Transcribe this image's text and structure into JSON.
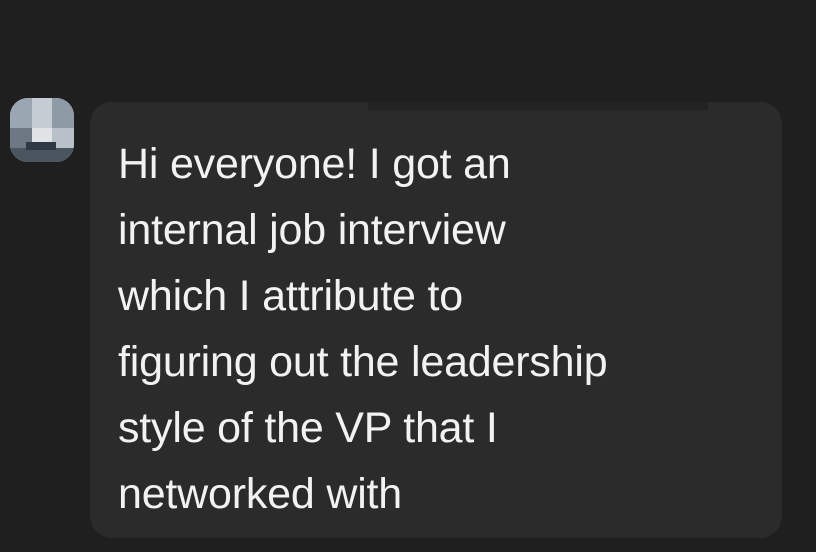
{
  "message": {
    "sender_avatar_icon": "profile-photo-avatar",
    "text": "Hi everyone! I got an\ninternal job interview\nwhich I attribute to\nfiguring out the leadership\nstyle of the VP that I\nnetworked with"
  },
  "colors": {
    "background": "#1f1f1f",
    "bubble": "#2b2b2b",
    "text": "#f2f2f2"
  }
}
